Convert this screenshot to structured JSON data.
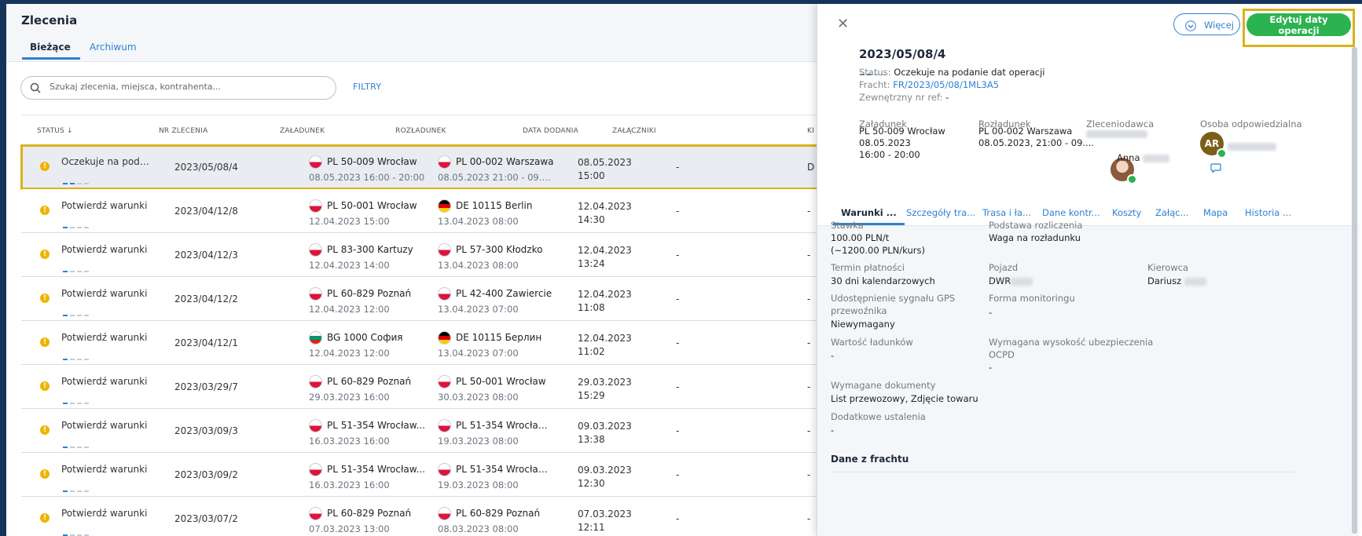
{
  "app": {
    "title": "Zlecenia",
    "tabs": [
      {
        "label": "Bieżące",
        "active": true
      },
      {
        "label": "Archiwum",
        "active": false
      }
    ],
    "search": {
      "placeholder": "Szukaj zlecenia, miejsca, kontrahenta..."
    },
    "filters_label": "FILTRY"
  },
  "table": {
    "headers": {
      "status": "STATUS ↓",
      "order": "NR ZLECENIA",
      "loading": "ZAŁADUNEK",
      "unloading": "ROZŁADUNEK",
      "date": "DATA DODANIA",
      "attachments": "ZAŁĄCZNIKI",
      "extra": "KI"
    },
    "rows": [
      {
        "status": "Oczekuje na podani...",
        "progress": 2,
        "order": "2023/05/08/4",
        "load_flag": "pl",
        "load_place": "PL 50-009 Wrocław",
        "load_time": "08.05.2023 16:00 - 20:00",
        "unload_flag": "pl",
        "unload_place": "PL 00-002 Warszawa",
        "unload_time": "08.05.2023 21:00 - 09.05...",
        "date_line1": "08.05.2023",
        "date_line2": "15:00",
        "attachments": "-",
        "extra": "D",
        "selected": true
      },
      {
        "status": "Potwierdź warunki",
        "progress": 1,
        "order": "2023/04/12/8",
        "load_flag": "pl",
        "load_place": "PL 50-001 Wrocław",
        "load_time": "12.04.2023 15:00",
        "unload_flag": "de",
        "unload_place": "DE 10115 Berlin",
        "unload_time": "13.04.2023 08:00",
        "date_line1": "12.04.2023",
        "date_line2": "14:30",
        "attachments": "-",
        "extra": "-"
      },
      {
        "status": "Potwierdź warunki",
        "progress": 1,
        "order": "2023/04/12/3",
        "load_flag": "pl",
        "load_place": "PL 83-300 Kartuzy",
        "load_time": "12.04.2023 14:00",
        "unload_flag": "pl",
        "unload_place": "PL 57-300 Kłodzko",
        "unload_time": "13.04.2023 08:00",
        "date_line1": "12.04.2023",
        "date_line2": "13:24",
        "attachments": "-",
        "extra": "-"
      },
      {
        "status": "Potwierdź warunki",
        "progress": 1,
        "order": "2023/04/12/2",
        "load_flag": "pl",
        "load_place": "PL 60-829 Poznań",
        "load_time": "12.04.2023 12:00",
        "unload_flag": "pl",
        "unload_place": "PL 42-400 Zawiercie",
        "unload_time": "13.04.2023 07:00",
        "date_line1": "12.04.2023",
        "date_line2": "11:08",
        "attachments": "-",
        "extra": "-"
      },
      {
        "status": "Potwierdź warunki",
        "progress": 1,
        "order": "2023/04/12/1",
        "load_flag": "bg",
        "load_place": "BG 1000 София",
        "load_time": "12.04.2023 12:00",
        "unload_flag": "de",
        "unload_place": "DE 10115 Берлин",
        "unload_time": "13.04.2023 07:00",
        "date_line1": "12.04.2023",
        "date_line2": "11:02",
        "attachments": "-",
        "extra": "-"
      },
      {
        "status": "Potwierdź warunki",
        "progress": 1,
        "order": "2023/03/29/7",
        "load_flag": "pl",
        "load_place": "PL 60-829 Poznań",
        "load_time": "29.03.2023 16:00",
        "unload_flag": "pl",
        "unload_place": "PL 50-001 Wrocław",
        "unload_time": "30.03.2023 08:00",
        "date_line1": "29.03.2023",
        "date_line2": "15:29",
        "attachments": "-",
        "extra": "-"
      },
      {
        "status": "Potwierdź warunki",
        "progress": 1,
        "order": "2023/03/09/3",
        "load_flag": "pl",
        "load_place": "PL 51-354 Wrocław...",
        "load_time": "16.03.2023 16:00",
        "unload_flag": "pl",
        "unload_place": "PL 51-354 Wrocław, ...",
        "unload_time": "19.03.2023 08:00",
        "date_line1": "09.03.2023",
        "date_line2": "13:38",
        "attachments": "-",
        "extra": "-"
      },
      {
        "status": "Potwierdź warunki",
        "progress": 1,
        "order": "2023/03/09/2",
        "load_flag": "pl",
        "load_place": "PL 51-354 Wrocław...",
        "load_time": "16.03.2023 16:00",
        "unload_flag": "pl",
        "unload_place": "PL 51-354 Wrocław, ...",
        "unload_time": "19.03.2023 08:00",
        "date_line1": "09.03.2023",
        "date_line2": "12:30",
        "attachments": "-",
        "extra": "-"
      },
      {
        "status": "Potwierdź warunki",
        "progress": 1,
        "order": "2023/03/07/2",
        "load_flag": "pl",
        "load_place": "PL 60-829 Poznań",
        "load_time": "07.03.2023 13:00",
        "unload_flag": "pl",
        "unload_place": "PL 60-829 Poznań",
        "unload_time": "08.03.2023 08:00",
        "date_line1": "07.03.2023",
        "date_line2": "12:11",
        "attachments": "-",
        "extra": "-"
      }
    ]
  },
  "panel": {
    "more_label": "Więcej",
    "edit_label": "Edytuj daty operacji",
    "title": "2023/05/08/4",
    "progress": 2,
    "status_label": "Status:",
    "status_value": "Oczekuje na podanie dat operacji",
    "freight_label": "Fracht:",
    "freight_value": "FR/2023/05/08/1ML3A5",
    "ref_label": "Zewnętrzny nr ref:",
    "ref_value": "-",
    "loading_label": "Załadunek",
    "loading_place": "PL 50-009 Wrocław",
    "loading_date": "08.05.2023",
    "loading_time": "16:00 - 20:00",
    "unloading_label": "Rozładunek",
    "unloading_place": "PL 00-002 Warszawa",
    "unloading_time": "08.05.2023, 21:00 - 09....",
    "client_label": "Zleceniodawca",
    "contact_name": "Anna",
    "responsible_label": "Osoba odpowiedzialna",
    "responsible_initials": "AR",
    "tabs": [
      "Warunki ...",
      "Szczegóły tra...",
      "Trasa i ła...",
      "Dane kontr...",
      "Koszty",
      "Załąc...",
      "Mapa",
      "Historia ..."
    ],
    "fields": {
      "rate_label": "Stawka",
      "rate_value": "100.00 PLN/t",
      "rate_sub": "(~1200.00 PLN/kurs)",
      "basis_label": "Podstawa rozliczenia",
      "basis_value": "Waga na rozładunku",
      "payment_label": "Termin płatności",
      "payment_value": "30 dni kalendarzowych",
      "vehicle_label": "Pojazd",
      "vehicle_value": "DWR",
      "driver_label": "Kierowca",
      "driver_value": "Dariusz",
      "gps_label_1": "Udostępnienie sygnału GPS",
      "gps_label_2": "przewoźnika",
      "gps_value": "Niewymagany",
      "monitoring_label": "Forma monitoringu",
      "monitoring_value": "-",
      "cargo_label": "Wartość ładunków",
      "cargo_value": "-",
      "insurance_label_1": "Wymagana wysokość ubezpieczenia",
      "insurance_label_2": "OCPD",
      "insurance_value": "-",
      "docs_label": "Wymagane dokumenty",
      "docs_value": "List przewozowy, Zdjęcie towaru",
      "extra_label": "Dodatkowe ustalenia",
      "extra_value": "-",
      "section_title": "Dane z frachtu"
    }
  },
  "colors": {
    "accent": "#2f80d1",
    "highlight": "#d8b21a",
    "success": "#2bb34f",
    "warning": "#f0b400",
    "background": "#14345c"
  }
}
